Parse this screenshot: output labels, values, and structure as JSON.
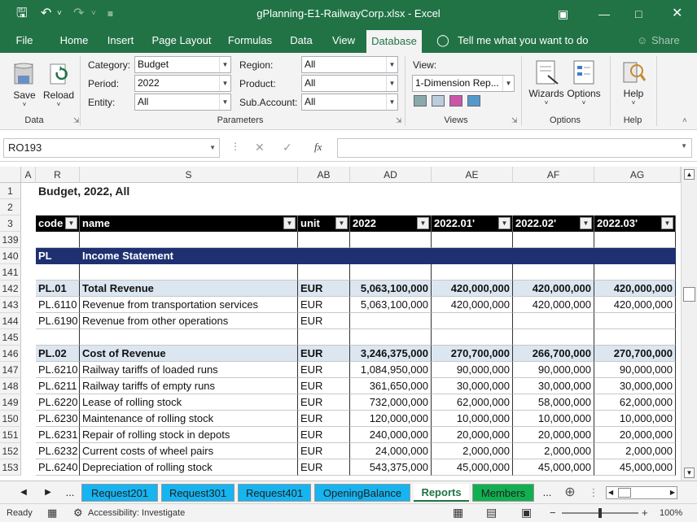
{
  "title": "gPlanning-E1-RailwayCorp.xlsx  -  Excel",
  "menu": [
    "File",
    "Home",
    "Insert",
    "Page Layout",
    "Formulas",
    "Data",
    "View",
    "Database"
  ],
  "tell": "Tell me what you want to do",
  "share": "Share",
  "params": {
    "category_label": "Category:",
    "category": "Budget",
    "period_label": "Period:",
    "period": "2022",
    "entity_label": "Entity:",
    "entity": "All",
    "region_label": "Region:",
    "region": "All",
    "product_label": "Product:",
    "product": "All",
    "subaccount_label": "Sub.Account:",
    "subaccount": "All",
    "view_label": "View:",
    "view": "1-Dimension Rep..."
  },
  "ribbon": {
    "save": "Save",
    "reload": "Reload",
    "wizards": "Wizards",
    "options": "Options",
    "help": "Help",
    "groups": [
      "Data",
      "Parameters",
      "Views",
      "Options",
      "Help"
    ]
  },
  "namebox": "RO193",
  "fx": "fx",
  "columns": [
    "A",
    "R",
    "S",
    "AB",
    "AD",
    "AE",
    "AF",
    "AG"
  ],
  "report_title": "Budget, 2022, All",
  "headers": [
    "code",
    "name",
    "unit",
    "2022",
    "2022.01'",
    "2022.02'",
    "2022.03'"
  ],
  "rows": [
    {
      "n": "139",
      "c": [
        "",
        "",
        "",
        "",
        "",
        "",
        ""
      ],
      "s": "blank"
    },
    {
      "n": "140",
      "c": [
        "PL",
        "Income Statement",
        "",
        "",
        "",
        "",
        ""
      ],
      "s": "section"
    },
    {
      "n": "141",
      "c": [
        "",
        "",
        "",
        "",
        "",
        "",
        ""
      ],
      "s": "blank"
    },
    {
      "n": "142",
      "c": [
        "PL.01",
        "Total Revenue",
        "EUR",
        "5,063,100,000",
        "420,000,000",
        "420,000,000",
        "420,000,000"
      ],
      "s": "total"
    },
    {
      "n": "143",
      "c": [
        "PL.6110",
        "Revenue from transportation services",
        "EUR",
        "5,063,100,000",
        "420,000,000",
        "420,000,000",
        "420,000,000"
      ],
      "s": "line"
    },
    {
      "n": "144",
      "c": [
        "PL.6190",
        "Revenue from other operations",
        "EUR",
        "",
        "",
        "",
        ""
      ],
      "s": "line"
    },
    {
      "n": "145",
      "c": [
        "",
        "",
        "",
        "",
        "",
        "",
        ""
      ],
      "s": "blank"
    },
    {
      "n": "146",
      "c": [
        "PL.02",
        "Cost of Revenue",
        "EUR",
        "3,246,375,000",
        "270,700,000",
        "266,700,000",
        "270,700,000"
      ],
      "s": "total"
    },
    {
      "n": "147",
      "c": [
        "PL.6210",
        "Railway tariffs of loaded runs",
        "EUR",
        "1,084,950,000",
        "90,000,000",
        "90,000,000",
        "90,000,000"
      ],
      "s": "line"
    },
    {
      "n": "148",
      "c": [
        "PL.6211",
        "Railway tariffs of empty runs",
        "EUR",
        "361,650,000",
        "30,000,000",
        "30,000,000",
        "30,000,000"
      ],
      "s": "line"
    },
    {
      "n": "149",
      "c": [
        "PL.6220",
        "Lease of rolling stock",
        "EUR",
        "732,000,000",
        "62,000,000",
        "58,000,000",
        "62,000,000"
      ],
      "s": "line"
    },
    {
      "n": "150",
      "c": [
        "PL.6230",
        "Maintenance of rolling stock",
        "EUR",
        "120,000,000",
        "10,000,000",
        "10,000,000",
        "10,000,000"
      ],
      "s": "line"
    },
    {
      "n": "151",
      "c": [
        "PL.6231",
        "Repair of rolling stock in depots",
        "EUR",
        "240,000,000",
        "20,000,000",
        "20,000,000",
        "20,000,000"
      ],
      "s": "line"
    },
    {
      "n": "152",
      "c": [
        "PL.6232",
        "Current costs of wheel pairs",
        "EUR",
        "24,000,000",
        "2,000,000",
        "2,000,000",
        "2,000,000"
      ],
      "s": "line"
    },
    {
      "n": "153",
      "c": [
        "PL.6240",
        "Depreciation of rolling stock",
        "EUR",
        "543,375,000",
        "45,000,000",
        "45,000,000",
        "45,000,000"
      ],
      "s": "line"
    }
  ],
  "sheet_tabs": [
    {
      "label": "Request201",
      "color": "#16b4f0"
    },
    {
      "label": "Request301",
      "color": "#16b4f0"
    },
    {
      "label": "Request401",
      "color": "#16b4f0"
    },
    {
      "label": "OpeningBalance",
      "color": "#16b4f0"
    },
    {
      "label": "Reports",
      "color": "#ffffff"
    },
    {
      "label": "Members",
      "color": "#10b050"
    }
  ],
  "status": {
    "ready": "Ready",
    "accessibility": "Accessibility: Investigate",
    "zoom": "100%"
  },
  "colors": {
    "brand": "#217346",
    "section_bg": "#1f3071",
    "total_bg": "#dce6f1",
    "header_bg": "#000000"
  }
}
